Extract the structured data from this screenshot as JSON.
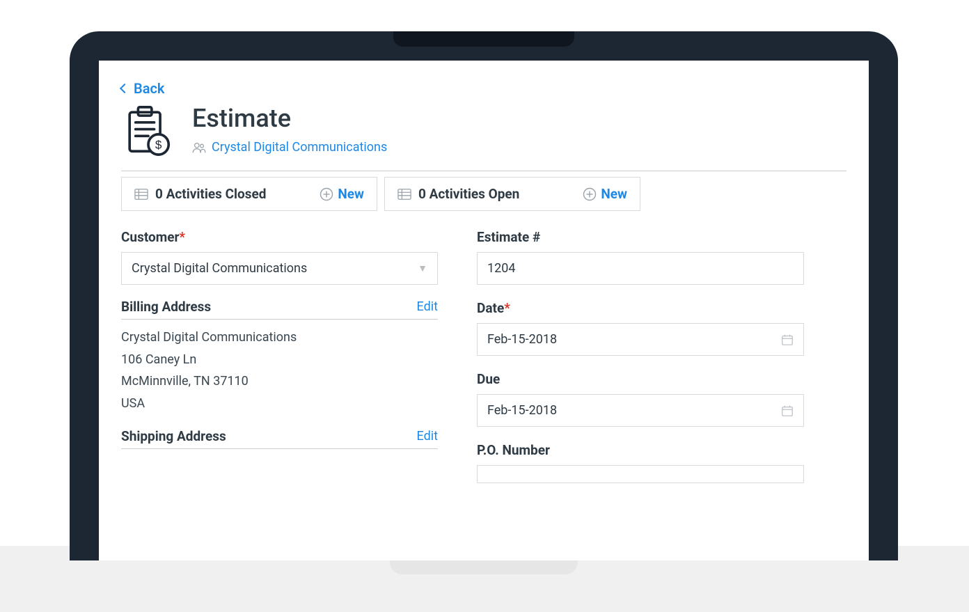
{
  "nav": {
    "back_label": "Back"
  },
  "header": {
    "title": "Estimate",
    "customer_link": "Crystal  Digital  Communications"
  },
  "activities": {
    "closed_label": "0 Activities Closed",
    "open_label": "0 Activities Open",
    "new_label": "New"
  },
  "form": {
    "customer_label": "Customer",
    "customer_value": "Crystal Digital Communications",
    "estimate_no_label": "Estimate #",
    "estimate_no_value": "1204",
    "date_label": "Date",
    "date_value": "Feb-15-2018",
    "due_label": "Due",
    "due_value": "Feb-15-2018",
    "po_label": "P.O. Number",
    "po_value": ""
  },
  "billing": {
    "label": "Billing Address",
    "edit": "Edit",
    "line1": "Crystal Digital Communications",
    "line2": "106 Caney Ln",
    "line3": "McMinnville, TN 37110",
    "line4": "USA"
  },
  "shipping": {
    "label": "Shipping Address",
    "edit": "Edit"
  }
}
